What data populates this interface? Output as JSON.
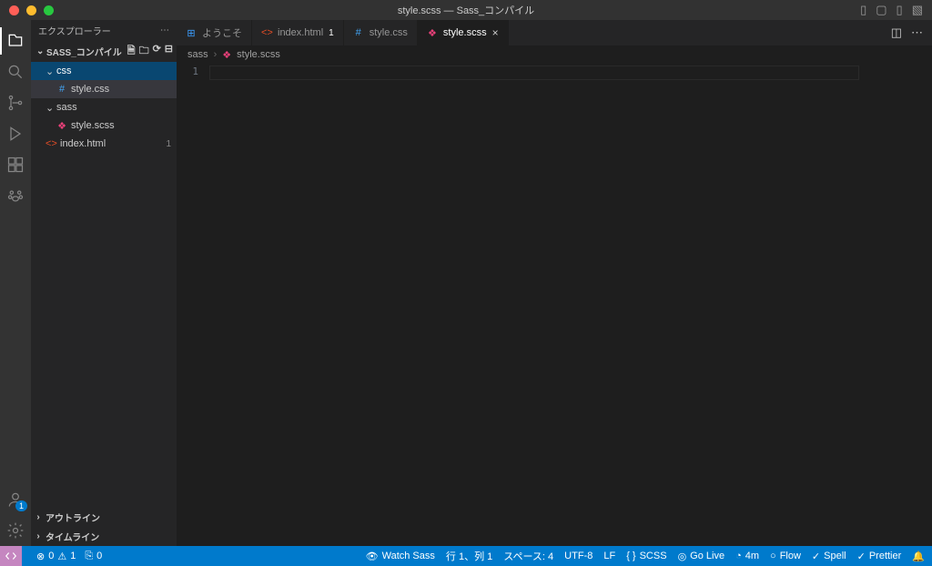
{
  "titlebar": {
    "title": "style.scss — Sass_コンパイル"
  },
  "sidebar": {
    "header": "エクスプローラー",
    "project": "SASS_コンパイル",
    "tree": {
      "css_folder": "css",
      "css_file": "style.css",
      "sass_folder": "sass",
      "sass_file": "style.scss",
      "index_file": "index.html",
      "index_badge": "1"
    },
    "outline": "アウトライン",
    "timeline": "タイムライン"
  },
  "tabs": {
    "welcome": "ようこそ",
    "index": "index.html",
    "index_badge": "1",
    "stylecss": "style.css",
    "stylescss": "style.scss"
  },
  "breadcrumb": {
    "a": "sass",
    "b": "style.scss"
  },
  "editor": {
    "line1": "1"
  },
  "status": {
    "errors": "0",
    "warnings": "1",
    "ports": "0",
    "watch": "Watch Sass",
    "cursor": "行 1、列 1",
    "spaces": "スペース: 4",
    "enc": "UTF-8",
    "eol": "LF",
    "lang": "SCSS",
    "golive": "Go Live",
    "time": "4m",
    "flow": "Flow",
    "spell": "Spell",
    "prettier": "Prettier"
  }
}
